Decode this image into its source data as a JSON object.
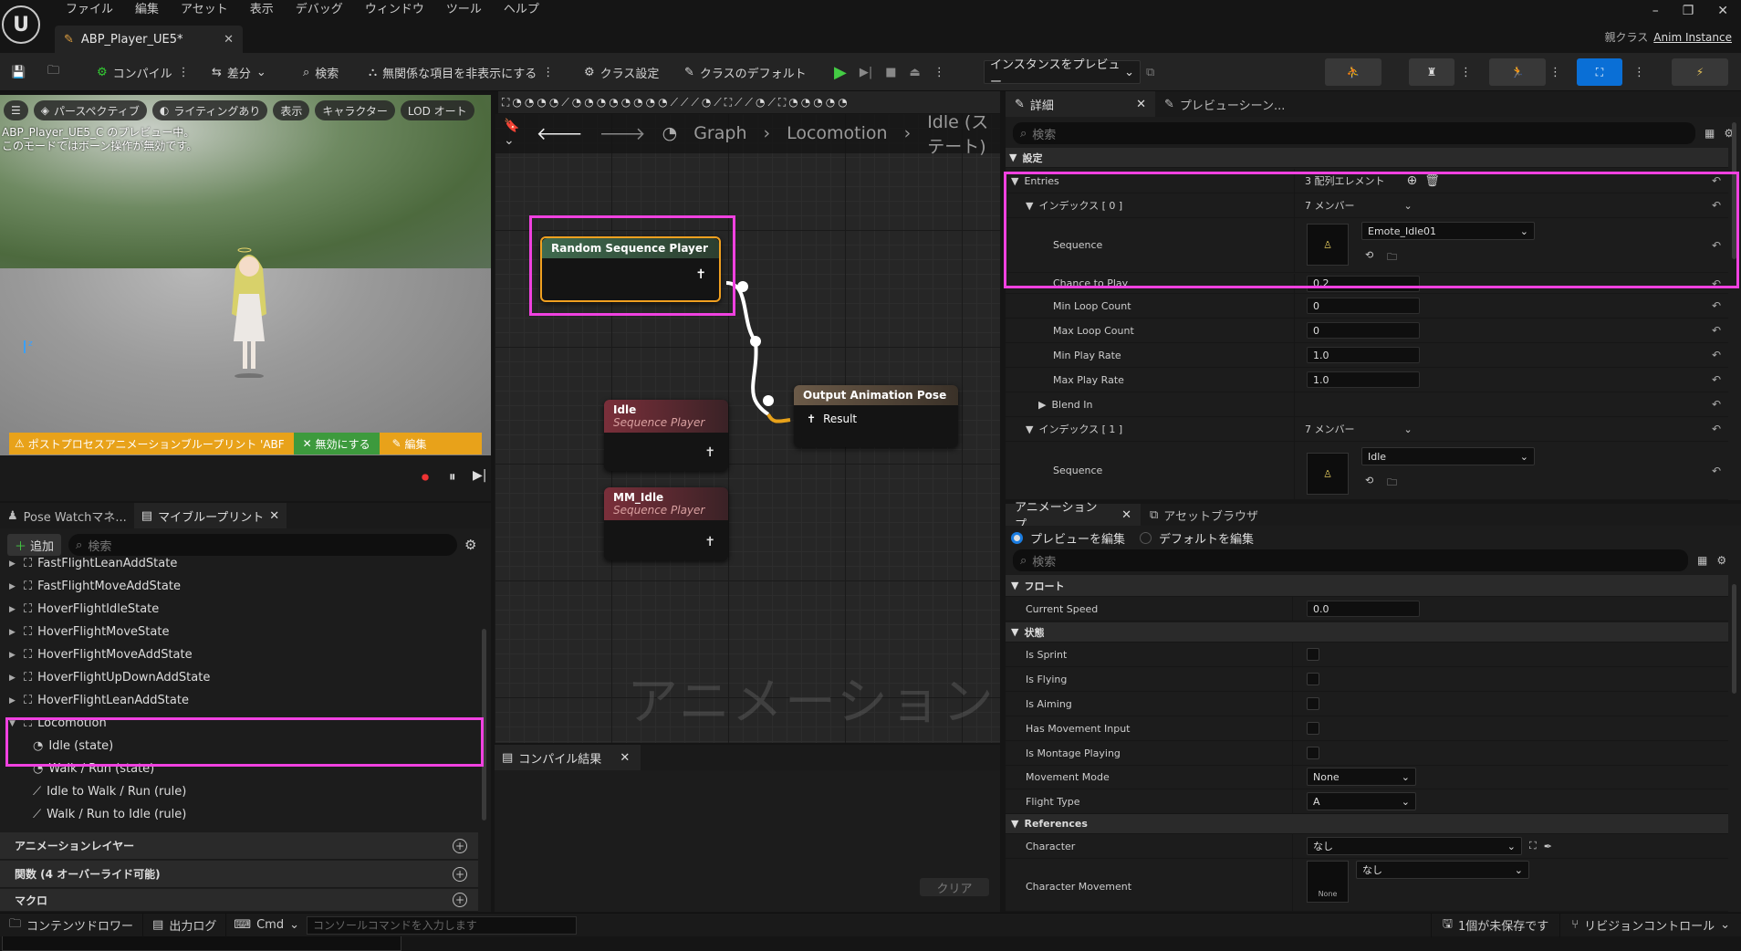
{
  "menu": [
    "ファイル",
    "編集",
    "アセット",
    "表示",
    "デバッグ",
    "ウィンドウ",
    "ツール",
    "ヘルプ"
  ],
  "doc_tab": {
    "title": "ABP_Player_UE5*"
  },
  "parent_class": {
    "label": "親クラス",
    "value": "Anim Instance"
  },
  "toolbar": {
    "compile": "コンパイル",
    "diff": "差分",
    "search": "検索",
    "hide_unrelated": "無関係な項目を非表示にする",
    "class_settings": "クラス設定",
    "class_defaults": "クラスのデフォルト",
    "preview_instance": "インスタンスをプレビュー"
  },
  "viewport": {
    "perspective": "パースペクティブ",
    "lighting": "ライティングあり",
    "show": "表示",
    "character": "キャラクター",
    "lod": "LOD オート",
    "msg1": "ABP_Player_UE5_C のプレビュー中。",
    "msg2": "このモードではボーン操作が無効です。",
    "warning": "ポストプロセスアニメーションブループリント 'ABF",
    "disable": "無効にする",
    "edit": "編集"
  },
  "left_tabs": {
    "pose_watch": "Pose Watchマネ...",
    "my_blueprint": "マイブループリント"
  },
  "left": {
    "add": "追加",
    "search_placeholder": "検索",
    "tree": [
      "FastFlightLeanAddState",
      "FastFlightMoveAddState",
      "HoverFlightIdleState",
      "HoverFlightMoveState",
      "HoverFlightMoveAddState",
      "HoverFlightUpDownAddState",
      "HoverFlightLeanAddState",
      "Locomotion",
      "Idle (state)",
      "Walk / Run (state)",
      "Idle to Walk / Run (rule)",
      "Walk / Run to Idle (rule)"
    ],
    "sections": [
      "アニメーションレイヤー",
      "関数 (4 オーバーライド可能)",
      "マクロ"
    ]
  },
  "graph": {
    "breadcrumb": [
      "Graph",
      "Locomotion",
      "Idle (ステート)"
    ],
    "watermark": "アニメーション",
    "nodes": {
      "random": "Random Sequence Player",
      "idle": "Idle",
      "idle_sub": "Sequence Player",
      "mm_idle": "MM_Idle",
      "mm_idle_sub": "Sequence Player",
      "output": "Output Animation Pose",
      "result": "Result"
    },
    "compile_tab": "コンパイル結果",
    "clear": "クリア"
  },
  "details": {
    "tab_details": "詳細",
    "tab_preview_scene": "プレビューシーン...",
    "search_placeholder": "検索",
    "section": "設定",
    "entries_label": "Entries",
    "entries_value": "3 配列エレメント",
    "index0": "インデックス [ 0 ]",
    "members": "7 メンバー",
    "sequence": "Sequence",
    "seq0": "Emote_Idle01",
    "chance": "Chance to Play",
    "chance_val": "0.2",
    "min_loop": "Min Loop Count",
    "min_loop_val": "0",
    "max_loop": "Max Loop Count",
    "max_loop_val": "0",
    "min_rate": "Min Play Rate",
    "min_rate_val": "1.0",
    "max_rate": "Max Play Rate",
    "max_rate_val": "1.0",
    "blend_in": "Blend In",
    "index1": "インデックス [ 1 ]",
    "seq1": "Idle"
  },
  "anim_preview": {
    "tab1": "アニメーションプ...",
    "tab2": "アセットブラウザ",
    "radio1": "プレビューを編集",
    "radio2": "デフォルトを編集",
    "search_placeholder": "検索",
    "flow": "フロート",
    "current_speed": "Current Speed",
    "current_speed_val": "0.0",
    "state": "状態",
    "bools": [
      "Is Sprint",
      "Is Flying",
      "Is Aiming",
      "Has Movement Input",
      "Is Montage Playing"
    ],
    "movement_mode": "Movement Mode",
    "movement_mode_val": "None",
    "flight_type": "Flight Type",
    "flight_type_val": "A",
    "references": "References",
    "character": "Character",
    "character_val": "なし",
    "char_movement": "Character Movement",
    "char_movement_val": "なし",
    "none_thumb": "None"
  },
  "status": {
    "content_drawer": "コンテンツドロワー",
    "output_log": "出力ログ",
    "cmd": "Cmd",
    "console_placeholder": "コンソールコマンドを入力します",
    "unsaved": "1個が未保存です",
    "revision": "リビジョンコントロール"
  }
}
